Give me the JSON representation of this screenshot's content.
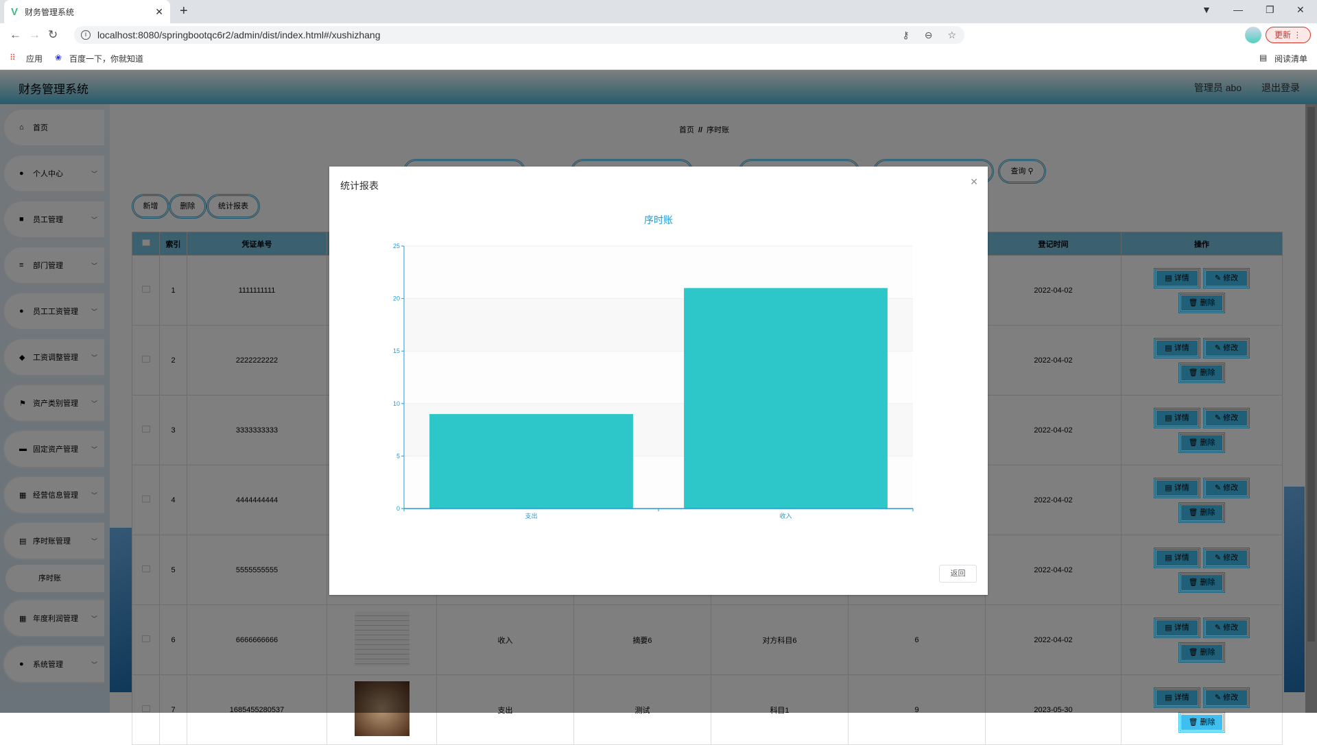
{
  "browser": {
    "tab_title": "财务管理系统",
    "url": "localhost:8080/springbootqc6r2/admin/dist/index.html#/xushizhang",
    "bookmarks": [
      "应用",
      "百度一下，你就知道"
    ],
    "reading_list": "阅读清单",
    "update_label": "更新"
  },
  "header": {
    "title": "财务管理系统",
    "user": "管理员 abo",
    "logout": "退出登录"
  },
  "sidebar": {
    "items": [
      {
        "label": "首页",
        "icon": "home-icon",
        "glyph": "⌂",
        "chevron": false
      },
      {
        "label": "个人中心",
        "icon": "user-icon",
        "glyph": "●",
        "chevron": true
      },
      {
        "label": "员工管理",
        "icon": "briefcase-icon",
        "glyph": "■",
        "chevron": true
      },
      {
        "label": "部门管理",
        "icon": "list-icon",
        "glyph": "≡",
        "chevron": true
      },
      {
        "label": "员工工资管理",
        "icon": "user-icon",
        "glyph": "●",
        "chevron": true
      },
      {
        "label": "工资调整管理",
        "icon": "pin-icon",
        "glyph": "◆",
        "chevron": true
      },
      {
        "label": "资产类别管理",
        "icon": "flag-icon",
        "glyph": "⚑",
        "chevron": true
      },
      {
        "label": "固定资产管理",
        "icon": "case-icon",
        "glyph": "▬",
        "chevron": true
      },
      {
        "label": "经营信息管理",
        "icon": "grid-icon",
        "glyph": "▦",
        "chevron": true
      },
      {
        "label": "序时账管理",
        "icon": "chart-icon",
        "glyph": "▤",
        "chevron": true,
        "sub": "序时账"
      },
      {
        "label": "年度利润管理",
        "icon": "grid-icon",
        "glyph": "▦",
        "chevron": true
      },
      {
        "label": "系统管理",
        "icon": "user-icon",
        "glyph": "●",
        "chevron": true
      }
    ]
  },
  "breadcrumb": {
    "home": "首页",
    "sep": "//",
    "current": "序时账"
  },
  "search": {
    "query_label": "查询"
  },
  "toolbar": {
    "add": "新增",
    "delete": "删除",
    "report": "统计报表"
  },
  "table": {
    "headers": {
      "index": "索引",
      "voucher": "凭证单号",
      "date": "登记时间",
      "actions": "操作"
    },
    "action_labels": {
      "detail": "详情",
      "edit": "修改",
      "delete": "删除"
    },
    "rows": [
      {
        "index": "1",
        "voucher": "1111111111",
        "date": "2022-04-02"
      },
      {
        "index": "2",
        "voucher": "2222222222",
        "date": "2022-04-02"
      },
      {
        "index": "3",
        "voucher": "3333333333",
        "date": "2022-04-02"
      },
      {
        "index": "4",
        "voucher": "4444444444",
        "date": "2022-04-02"
      },
      {
        "index": "5",
        "voucher": "5555555555",
        "date": "2022-04-02"
      },
      {
        "index": "6",
        "voucher": "6666666666",
        "type": "收入",
        "summary": "摘要6",
        "subject": "对方科目6",
        "amount": "6",
        "date": "2022-04-02"
      },
      {
        "index": "7",
        "voucher": "1685455280537",
        "type": "支出",
        "summary": "测试",
        "subject": "科目1",
        "amount": "9",
        "date": "2023-05-30"
      }
    ]
  },
  "modal": {
    "title": "统计报表",
    "back": "返回"
  },
  "chart_data": {
    "type": "bar",
    "title": "序时账",
    "categories": [
      "支出",
      "收入"
    ],
    "values": [
      9,
      21
    ],
    "ylim": [
      0,
      25
    ],
    "yticks": [
      0,
      5,
      10,
      15,
      20,
      25
    ],
    "color": "#2ec7c9",
    "axis_color": "#1e9ad6",
    "grid": true
  }
}
